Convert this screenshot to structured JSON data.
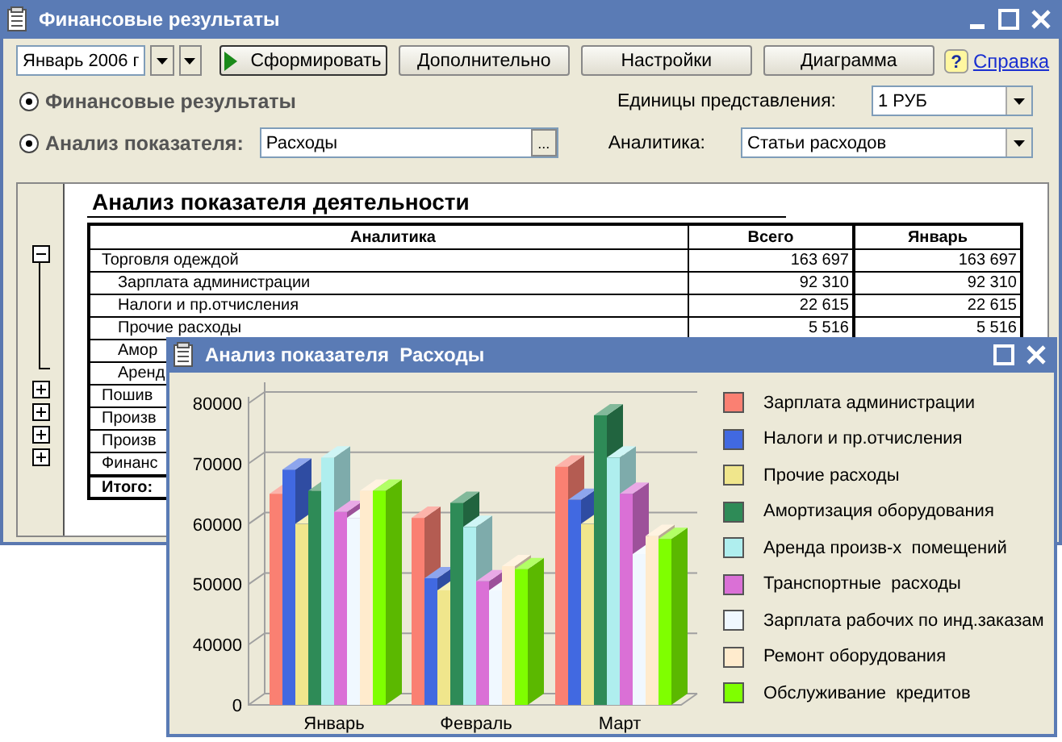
{
  "window": {
    "title": "Финансовые результаты"
  },
  "toolbar": {
    "period": "Январь 2006 г",
    "help_icon": "?",
    "buttons": [
      {
        "label": "Сформировать",
        "kind": "run"
      },
      {
        "label": "Дополнительно",
        "kind": "plain"
      },
      {
        "label": "Настройки",
        "kind": "plain"
      },
      {
        "label": "Диаграмма",
        "kind": "plain"
      }
    ],
    "help": "Справка"
  },
  "modes": [
    {
      "label": "Финансовые результаты",
      "selected": true
    },
    {
      "label": "Анализ показателя:",
      "selected": true
    }
  ],
  "indicator_field": {
    "value": "Расходы",
    "button": "..."
  },
  "units": {
    "label": "Единицы представления:",
    "value": "1 РУБ"
  },
  "analytics": {
    "label": "Аналитика:",
    "value": "Статьи расходов"
  },
  "report": {
    "title": "Анализ показателя деятельности",
    "columns": [
      "Аналитика",
      "Всего",
      "Январь"
    ],
    "rows": [
      {
        "cells": [
          "Торговля одеждой",
          "163 697",
          "163 697"
        ],
        "expanded": true,
        "children": [
          {
            "cells": [
              "Зарплата администрации",
              "92 310",
              "92 310"
            ]
          },
          {
            "cells": [
              "Налоги и пр.отчисления",
              "22 615",
              "22 615"
            ]
          },
          {
            "cells": [
              "Прочие расходы",
              "5 516",
              "5 516"
            ]
          },
          {
            "cells": [
              "Амор"
            ]
          },
          {
            "cells": [
              "Аренд"
            ]
          }
        ]
      },
      {
        "cells": [
          "Пошив"
        ],
        "expanded": false
      },
      {
        "cells": [
          "Произв"
        ],
        "expanded": false
      },
      {
        "cells": [
          "Произв"
        ],
        "expanded": false
      },
      {
        "cells": [
          "Финанс"
        ],
        "expanded": false
      }
    ],
    "total": "Итого:"
  },
  "chart_window": {
    "title": "Анализ показателя  Расходы",
    "y_labels": [
      "80000",
      "70000",
      "60000",
      "50000",
      "40000",
      "0"
    ],
    "categories": [
      "Январь",
      "Февраль",
      "Март"
    ],
    "legend": [
      {
        "label": "Зарплата администрации",
        "color": "#fa8072"
      },
      {
        "label": "Налоги и пр.отчисления",
        "color": "#4169e1"
      },
      {
        "label": "Прочие расходы",
        "color": "#f0e68c"
      },
      {
        "label": "Амортизация оборудования",
        "color": "#2e8b57"
      },
      {
        "label": "Аренда произв-х  помещений",
        "color": "#afeeee"
      },
      {
        "label": "Транспортные  расходы",
        "color": "#da70d6"
      },
      {
        "label": "Зарплата рабочих по инд.заказам",
        "color": "#f0f8ff"
      },
      {
        "label": "Ремонт оборудования",
        "color": "#ffebcd"
      },
      {
        "label": "Обслуживание  кредитов",
        "color": "#7fff00"
      }
    ]
  }
}
